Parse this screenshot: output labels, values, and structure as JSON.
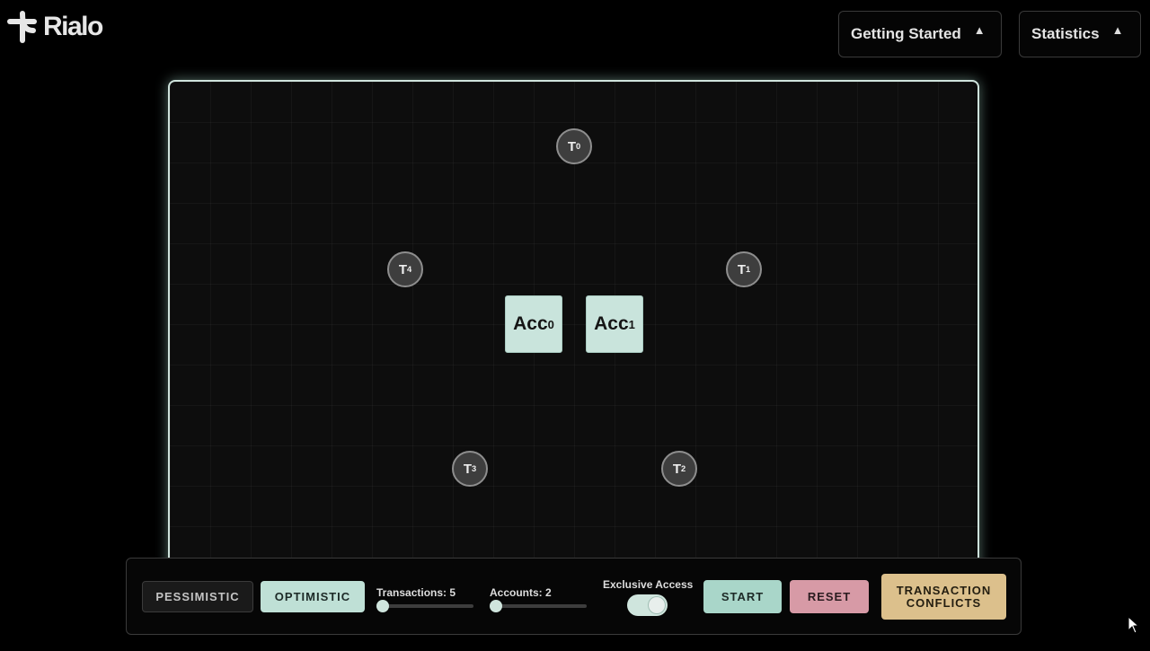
{
  "header": {
    "brand": "Rialo",
    "menus": [
      {
        "label": "Getting Started",
        "caret": "▲"
      },
      {
        "label": "Statistics",
        "caret": "▲"
      }
    ]
  },
  "canvas": {
    "transactions": [
      {
        "letter": "T",
        "index": "0"
      },
      {
        "letter": "T",
        "index": "1"
      },
      {
        "letter": "T",
        "index": "2"
      },
      {
        "letter": "T",
        "index": "3"
      },
      {
        "letter": "T",
        "index": "4"
      }
    ],
    "accounts": [
      {
        "name": "Acc",
        "index": "0"
      },
      {
        "name": "Acc",
        "index": "1"
      }
    ]
  },
  "controls": {
    "pessimistic_label": "PESSIMISTIC",
    "optimistic_label": "OPTIMISTIC",
    "transactions_label": "Transactions: 5",
    "transactions_value": 5,
    "accounts_label": "Accounts: 2",
    "accounts_value": 2,
    "exclusive_access_label": "Exclusive Access",
    "exclusive_access_on": true,
    "start_label": "START",
    "reset_label": "RESET",
    "conflicts_label_line1": "TRANSACTION",
    "conflicts_label_line2": "CONFLICTS"
  },
  "colors": {
    "accent": "#c9e4dc",
    "reset": "#d79aa6",
    "conflicts": "#dcc08c",
    "background": "#000000"
  },
  "icons": {
    "logo": "rialo-logo-icon",
    "menu_caret": "caret-up-icon",
    "pointer": "mouse-cursor-icon"
  }
}
